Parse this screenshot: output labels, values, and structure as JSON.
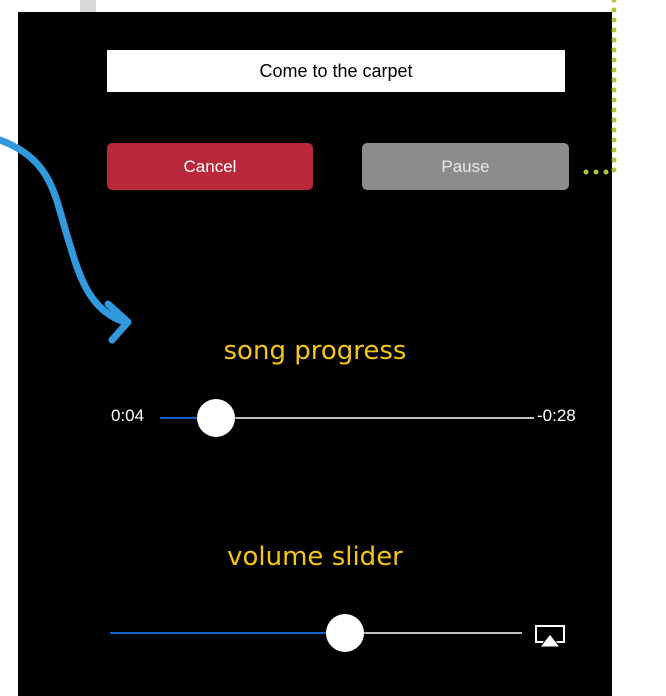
{
  "now_playing": {
    "title": "Come to the carpet"
  },
  "buttons": {
    "cancel_label": "Cancel",
    "pause_label": "Pause",
    "cancel_color": "#b8283a",
    "pause_color": "#8c8c8c"
  },
  "captions": {
    "song_progress": "song progress",
    "volume_slider": "volume slider",
    "color": "#f5c518"
  },
  "progress": {
    "elapsed": "0:04",
    "remaining": "-0:28",
    "fraction": 0.15
  },
  "volume": {
    "fraction": 0.57
  },
  "colors": {
    "track_filled": "#1560d0",
    "track_empty": "#c0c0c0",
    "arrow": "#3399dd",
    "dotted_line": "#a8c83a"
  },
  "icons": {
    "airplay": "airplay-icon"
  }
}
